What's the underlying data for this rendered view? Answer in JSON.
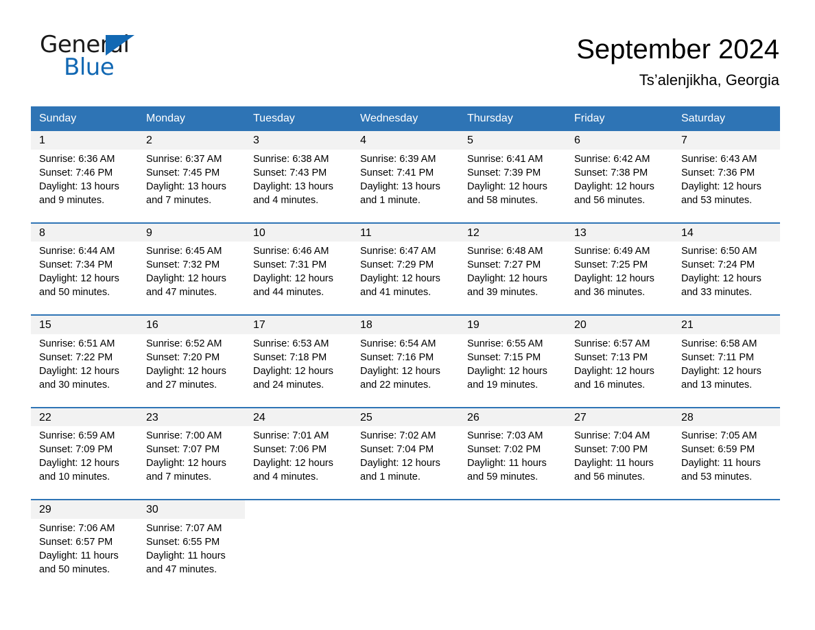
{
  "brand": {
    "name_part1": "General",
    "name_part2": "Blue",
    "triangle_icon": "triangle-icon",
    "accent_color": "#1268b3"
  },
  "header": {
    "month_title": "September 2024",
    "location": "Ts’alenjikha, Georgia"
  },
  "calendar": {
    "header_color": "#2e74b5",
    "daynum_bg": "#f2f2f2",
    "weekday_headers": [
      "Sunday",
      "Monday",
      "Tuesday",
      "Wednesday",
      "Thursday",
      "Friday",
      "Saturday"
    ],
    "weeks": [
      [
        {
          "day": "1",
          "sunrise": "Sunrise: 6:36 AM",
          "sunset": "Sunset: 7:46 PM",
          "daylight1": "Daylight: 13 hours",
          "daylight2": "and 9 minutes."
        },
        {
          "day": "2",
          "sunrise": "Sunrise: 6:37 AM",
          "sunset": "Sunset: 7:45 PM",
          "daylight1": "Daylight: 13 hours",
          "daylight2": "and 7 minutes."
        },
        {
          "day": "3",
          "sunrise": "Sunrise: 6:38 AM",
          "sunset": "Sunset: 7:43 PM",
          "daylight1": "Daylight: 13 hours",
          "daylight2": "and 4 minutes."
        },
        {
          "day": "4",
          "sunrise": "Sunrise: 6:39 AM",
          "sunset": "Sunset: 7:41 PM",
          "daylight1": "Daylight: 13 hours",
          "daylight2": "and 1 minute."
        },
        {
          "day": "5",
          "sunrise": "Sunrise: 6:41 AM",
          "sunset": "Sunset: 7:39 PM",
          "daylight1": "Daylight: 12 hours",
          "daylight2": "and 58 minutes."
        },
        {
          "day": "6",
          "sunrise": "Sunrise: 6:42 AM",
          "sunset": "Sunset: 7:38 PM",
          "daylight1": "Daylight: 12 hours",
          "daylight2": "and 56 minutes."
        },
        {
          "day": "7",
          "sunrise": "Sunrise: 6:43 AM",
          "sunset": "Sunset: 7:36 PM",
          "daylight1": "Daylight: 12 hours",
          "daylight2": "and 53 minutes."
        }
      ],
      [
        {
          "day": "8",
          "sunrise": "Sunrise: 6:44 AM",
          "sunset": "Sunset: 7:34 PM",
          "daylight1": "Daylight: 12 hours",
          "daylight2": "and 50 minutes."
        },
        {
          "day": "9",
          "sunrise": "Sunrise: 6:45 AM",
          "sunset": "Sunset: 7:32 PM",
          "daylight1": "Daylight: 12 hours",
          "daylight2": "and 47 minutes."
        },
        {
          "day": "10",
          "sunrise": "Sunrise: 6:46 AM",
          "sunset": "Sunset: 7:31 PM",
          "daylight1": "Daylight: 12 hours",
          "daylight2": "and 44 minutes."
        },
        {
          "day": "11",
          "sunrise": "Sunrise: 6:47 AM",
          "sunset": "Sunset: 7:29 PM",
          "daylight1": "Daylight: 12 hours",
          "daylight2": "and 41 minutes."
        },
        {
          "day": "12",
          "sunrise": "Sunrise: 6:48 AM",
          "sunset": "Sunset: 7:27 PM",
          "daylight1": "Daylight: 12 hours",
          "daylight2": "and 39 minutes."
        },
        {
          "day": "13",
          "sunrise": "Sunrise: 6:49 AM",
          "sunset": "Sunset: 7:25 PM",
          "daylight1": "Daylight: 12 hours",
          "daylight2": "and 36 minutes."
        },
        {
          "day": "14",
          "sunrise": "Sunrise: 6:50 AM",
          "sunset": "Sunset: 7:24 PM",
          "daylight1": "Daylight: 12 hours",
          "daylight2": "and 33 minutes."
        }
      ],
      [
        {
          "day": "15",
          "sunrise": "Sunrise: 6:51 AM",
          "sunset": "Sunset: 7:22 PM",
          "daylight1": "Daylight: 12 hours",
          "daylight2": "and 30 minutes."
        },
        {
          "day": "16",
          "sunrise": "Sunrise: 6:52 AM",
          "sunset": "Sunset: 7:20 PM",
          "daylight1": "Daylight: 12 hours",
          "daylight2": "and 27 minutes."
        },
        {
          "day": "17",
          "sunrise": "Sunrise: 6:53 AM",
          "sunset": "Sunset: 7:18 PM",
          "daylight1": "Daylight: 12 hours",
          "daylight2": "and 24 minutes."
        },
        {
          "day": "18",
          "sunrise": "Sunrise: 6:54 AM",
          "sunset": "Sunset: 7:16 PM",
          "daylight1": "Daylight: 12 hours",
          "daylight2": "and 22 minutes."
        },
        {
          "day": "19",
          "sunrise": "Sunrise: 6:55 AM",
          "sunset": "Sunset: 7:15 PM",
          "daylight1": "Daylight: 12 hours",
          "daylight2": "and 19 minutes."
        },
        {
          "day": "20",
          "sunrise": "Sunrise: 6:57 AM",
          "sunset": "Sunset: 7:13 PM",
          "daylight1": "Daylight: 12 hours",
          "daylight2": "and 16 minutes."
        },
        {
          "day": "21",
          "sunrise": "Sunrise: 6:58 AM",
          "sunset": "Sunset: 7:11 PM",
          "daylight1": "Daylight: 12 hours",
          "daylight2": "and 13 minutes."
        }
      ],
      [
        {
          "day": "22",
          "sunrise": "Sunrise: 6:59 AM",
          "sunset": "Sunset: 7:09 PM",
          "daylight1": "Daylight: 12 hours",
          "daylight2": "and 10 minutes."
        },
        {
          "day": "23",
          "sunrise": "Sunrise: 7:00 AM",
          "sunset": "Sunset: 7:07 PM",
          "daylight1": "Daylight: 12 hours",
          "daylight2": "and 7 minutes."
        },
        {
          "day": "24",
          "sunrise": "Sunrise: 7:01 AM",
          "sunset": "Sunset: 7:06 PM",
          "daylight1": "Daylight: 12 hours",
          "daylight2": "and 4 minutes."
        },
        {
          "day": "25",
          "sunrise": "Sunrise: 7:02 AM",
          "sunset": "Sunset: 7:04 PM",
          "daylight1": "Daylight: 12 hours",
          "daylight2": "and 1 minute."
        },
        {
          "day": "26",
          "sunrise": "Sunrise: 7:03 AM",
          "sunset": "Sunset: 7:02 PM",
          "daylight1": "Daylight: 11 hours",
          "daylight2": "and 59 minutes."
        },
        {
          "day": "27",
          "sunrise": "Sunrise: 7:04 AM",
          "sunset": "Sunset: 7:00 PM",
          "daylight1": "Daylight: 11 hours",
          "daylight2": "and 56 minutes."
        },
        {
          "day": "28",
          "sunrise": "Sunrise: 7:05 AM",
          "sunset": "Sunset: 6:59 PM",
          "daylight1": "Daylight: 11 hours",
          "daylight2": "and 53 minutes."
        }
      ],
      [
        {
          "day": "29",
          "sunrise": "Sunrise: 7:06 AM",
          "sunset": "Sunset: 6:57 PM",
          "daylight1": "Daylight: 11 hours",
          "daylight2": "and 50 minutes."
        },
        {
          "day": "30",
          "sunrise": "Sunrise: 7:07 AM",
          "sunset": "Sunset: 6:55 PM",
          "daylight1": "Daylight: 11 hours",
          "daylight2": "and 47 minutes."
        },
        {
          "day": "",
          "sunrise": "",
          "sunset": "",
          "daylight1": "",
          "daylight2": ""
        },
        {
          "day": "",
          "sunrise": "",
          "sunset": "",
          "daylight1": "",
          "daylight2": ""
        },
        {
          "day": "",
          "sunrise": "",
          "sunset": "",
          "daylight1": "",
          "daylight2": ""
        },
        {
          "day": "",
          "sunrise": "",
          "sunset": "",
          "daylight1": "",
          "daylight2": ""
        },
        {
          "day": "",
          "sunrise": "",
          "sunset": "",
          "daylight1": "",
          "daylight2": ""
        }
      ]
    ]
  }
}
